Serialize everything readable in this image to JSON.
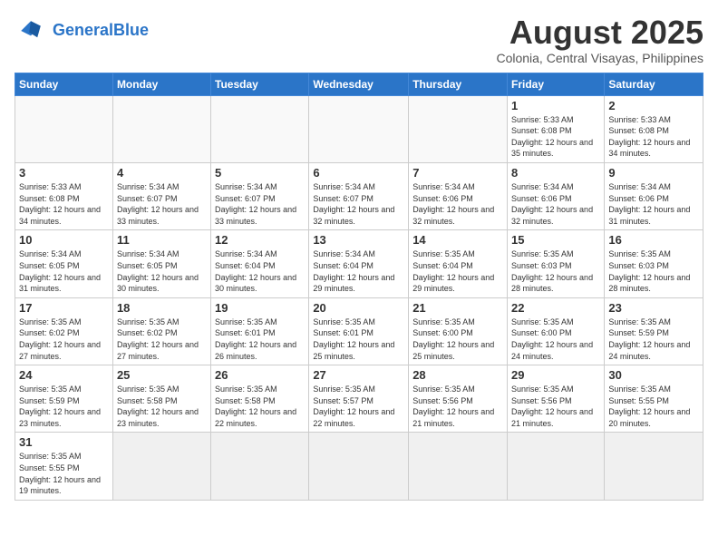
{
  "logo": {
    "text_general": "General",
    "text_blue": "Blue"
  },
  "header": {
    "title": "August 2025",
    "subtitle": "Colonia, Central Visayas, Philippines"
  },
  "weekdays": [
    "Sunday",
    "Monday",
    "Tuesday",
    "Wednesday",
    "Thursday",
    "Friday",
    "Saturday"
  ],
  "weeks": [
    [
      {
        "day": "",
        "info": ""
      },
      {
        "day": "",
        "info": ""
      },
      {
        "day": "",
        "info": ""
      },
      {
        "day": "",
        "info": ""
      },
      {
        "day": "",
        "info": ""
      },
      {
        "day": "1",
        "info": "Sunrise: 5:33 AM\nSunset: 6:08 PM\nDaylight: 12 hours and 35 minutes."
      },
      {
        "day": "2",
        "info": "Sunrise: 5:33 AM\nSunset: 6:08 PM\nDaylight: 12 hours and 34 minutes."
      }
    ],
    [
      {
        "day": "3",
        "info": "Sunrise: 5:33 AM\nSunset: 6:08 PM\nDaylight: 12 hours and 34 minutes."
      },
      {
        "day": "4",
        "info": "Sunrise: 5:34 AM\nSunset: 6:07 PM\nDaylight: 12 hours and 33 minutes."
      },
      {
        "day": "5",
        "info": "Sunrise: 5:34 AM\nSunset: 6:07 PM\nDaylight: 12 hours and 33 minutes."
      },
      {
        "day": "6",
        "info": "Sunrise: 5:34 AM\nSunset: 6:07 PM\nDaylight: 12 hours and 32 minutes."
      },
      {
        "day": "7",
        "info": "Sunrise: 5:34 AM\nSunset: 6:06 PM\nDaylight: 12 hours and 32 minutes."
      },
      {
        "day": "8",
        "info": "Sunrise: 5:34 AM\nSunset: 6:06 PM\nDaylight: 12 hours and 32 minutes."
      },
      {
        "day": "9",
        "info": "Sunrise: 5:34 AM\nSunset: 6:06 PM\nDaylight: 12 hours and 31 minutes."
      }
    ],
    [
      {
        "day": "10",
        "info": "Sunrise: 5:34 AM\nSunset: 6:05 PM\nDaylight: 12 hours and 31 minutes."
      },
      {
        "day": "11",
        "info": "Sunrise: 5:34 AM\nSunset: 6:05 PM\nDaylight: 12 hours and 30 minutes."
      },
      {
        "day": "12",
        "info": "Sunrise: 5:34 AM\nSunset: 6:04 PM\nDaylight: 12 hours and 30 minutes."
      },
      {
        "day": "13",
        "info": "Sunrise: 5:34 AM\nSunset: 6:04 PM\nDaylight: 12 hours and 29 minutes."
      },
      {
        "day": "14",
        "info": "Sunrise: 5:35 AM\nSunset: 6:04 PM\nDaylight: 12 hours and 29 minutes."
      },
      {
        "day": "15",
        "info": "Sunrise: 5:35 AM\nSunset: 6:03 PM\nDaylight: 12 hours and 28 minutes."
      },
      {
        "day": "16",
        "info": "Sunrise: 5:35 AM\nSunset: 6:03 PM\nDaylight: 12 hours and 28 minutes."
      }
    ],
    [
      {
        "day": "17",
        "info": "Sunrise: 5:35 AM\nSunset: 6:02 PM\nDaylight: 12 hours and 27 minutes."
      },
      {
        "day": "18",
        "info": "Sunrise: 5:35 AM\nSunset: 6:02 PM\nDaylight: 12 hours and 27 minutes."
      },
      {
        "day": "19",
        "info": "Sunrise: 5:35 AM\nSunset: 6:01 PM\nDaylight: 12 hours and 26 minutes."
      },
      {
        "day": "20",
        "info": "Sunrise: 5:35 AM\nSunset: 6:01 PM\nDaylight: 12 hours and 25 minutes."
      },
      {
        "day": "21",
        "info": "Sunrise: 5:35 AM\nSunset: 6:00 PM\nDaylight: 12 hours and 25 minutes."
      },
      {
        "day": "22",
        "info": "Sunrise: 5:35 AM\nSunset: 6:00 PM\nDaylight: 12 hours and 24 minutes."
      },
      {
        "day": "23",
        "info": "Sunrise: 5:35 AM\nSunset: 5:59 PM\nDaylight: 12 hours and 24 minutes."
      }
    ],
    [
      {
        "day": "24",
        "info": "Sunrise: 5:35 AM\nSunset: 5:59 PM\nDaylight: 12 hours and 23 minutes."
      },
      {
        "day": "25",
        "info": "Sunrise: 5:35 AM\nSunset: 5:58 PM\nDaylight: 12 hours and 23 minutes."
      },
      {
        "day": "26",
        "info": "Sunrise: 5:35 AM\nSunset: 5:58 PM\nDaylight: 12 hours and 22 minutes."
      },
      {
        "day": "27",
        "info": "Sunrise: 5:35 AM\nSunset: 5:57 PM\nDaylight: 12 hours and 22 minutes."
      },
      {
        "day": "28",
        "info": "Sunrise: 5:35 AM\nSunset: 5:56 PM\nDaylight: 12 hours and 21 minutes."
      },
      {
        "day": "29",
        "info": "Sunrise: 5:35 AM\nSunset: 5:56 PM\nDaylight: 12 hours and 21 minutes."
      },
      {
        "day": "30",
        "info": "Sunrise: 5:35 AM\nSunset: 5:55 PM\nDaylight: 12 hours and 20 minutes."
      }
    ],
    [
      {
        "day": "31",
        "info": "Sunrise: 5:35 AM\nSunset: 5:55 PM\nDaylight: 12 hours and 19 minutes."
      },
      {
        "day": "",
        "info": ""
      },
      {
        "day": "",
        "info": ""
      },
      {
        "day": "",
        "info": ""
      },
      {
        "day": "",
        "info": ""
      },
      {
        "day": "",
        "info": ""
      },
      {
        "day": "",
        "info": ""
      }
    ]
  ]
}
